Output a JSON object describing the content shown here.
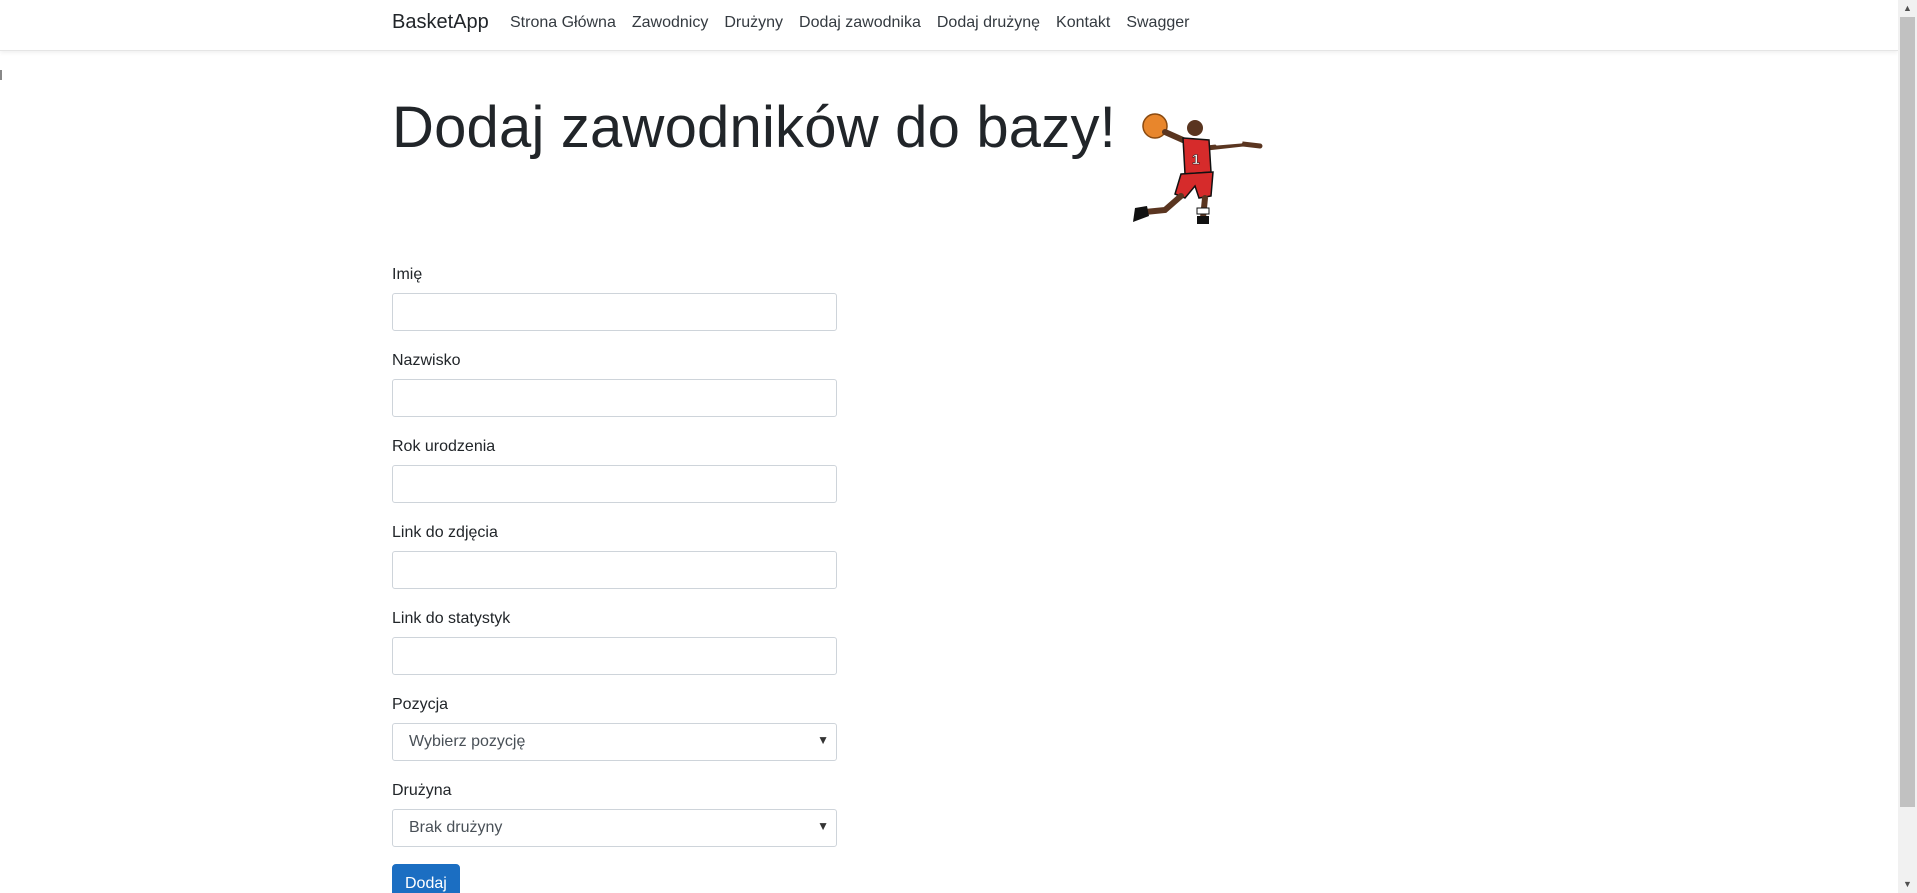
{
  "navbar": {
    "brand": "BasketApp",
    "links": [
      {
        "label": "Strona Główna"
      },
      {
        "label": "Zawodnicy"
      },
      {
        "label": "Drużyny"
      },
      {
        "label": "Dodaj zawodnika"
      },
      {
        "label": "Dodaj drużynę"
      },
      {
        "label": "Kontakt"
      },
      {
        "label": "Swagger"
      }
    ]
  },
  "page": {
    "title": "Dodaj zawodników do bazy!",
    "image_icon": "basketball-player-icon"
  },
  "form": {
    "first_name": {
      "label": "Imię",
      "value": ""
    },
    "last_name": {
      "label": "Nazwisko",
      "value": ""
    },
    "birth_year": {
      "label": "Rok urodzenia",
      "value": ""
    },
    "photo_link": {
      "label": "Link do zdjęcia",
      "value": ""
    },
    "stats_link": {
      "label": "Link do statystyk",
      "value": ""
    },
    "position": {
      "label": "Pozycja",
      "selected": "Wybierz pozycję"
    },
    "team": {
      "label": "Drużyna",
      "selected": "Brak drużyny"
    },
    "submit_label": "Dodaj"
  },
  "colors": {
    "primary_button": "#1b6ec2",
    "jersey": "#d62b2b",
    "ball": "#e8862c"
  }
}
